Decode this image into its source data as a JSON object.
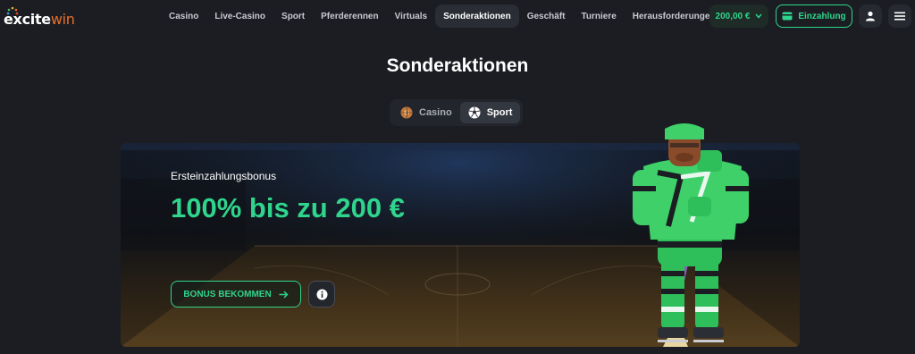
{
  "brand": {
    "name_prefix": "excite",
    "name_suffix": "win",
    "accent": "#e9702a"
  },
  "nav": {
    "items": [
      {
        "label": "Casino",
        "active": false
      },
      {
        "label": "Live-Casino",
        "active": false
      },
      {
        "label": "Sport",
        "active": false
      },
      {
        "label": "Pferderennen",
        "active": false
      },
      {
        "label": "Virtuals",
        "active": false
      },
      {
        "label": "Sonderaktionen",
        "active": true
      },
      {
        "label": "Geschäft",
        "active": false
      },
      {
        "label": "Turniere",
        "active": false
      },
      {
        "label": "Herausforderungen",
        "active": false
      }
    ]
  },
  "account": {
    "balance": "200,00 €",
    "deposit_label": "Einzahlung",
    "user_icon": "user-icon",
    "menu_icon": "hamburger-menu-icon"
  },
  "page": {
    "title": "Sonderaktionen"
  },
  "tabs": [
    {
      "label": "Casino",
      "icon": "roulette-icon",
      "active": false
    },
    {
      "label": "Sport",
      "icon": "soccer-ball-icon",
      "active": true
    }
  ],
  "promo": {
    "subtitle": "Ersteinzahlungsbonus",
    "headline": "100% bis zu 200 €",
    "cta_label": "BONUS BEKOMMEN",
    "cta_icon": "arrow-right-icon",
    "info_icon": "info-icon",
    "background": "basketball-court-arena",
    "mascot": "hockey-player-mascot"
  },
  "colors": {
    "background": "#1b1d22",
    "accent_green": "#2fd58c",
    "active_nav": "#2a2d34"
  }
}
